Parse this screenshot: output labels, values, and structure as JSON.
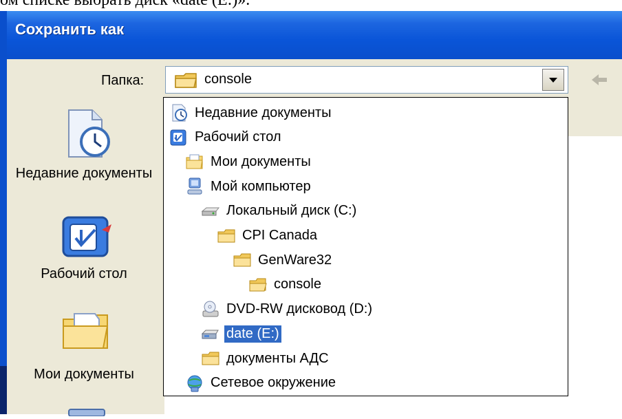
{
  "caption": "ом списке выбрать диск «date (E:)».",
  "window": {
    "title": "Сохранить как"
  },
  "folder_bar": {
    "label": "Папка:",
    "current_value": "console"
  },
  "places_bar": {
    "items": [
      {
        "label": "Недавние документы",
        "icon": "recent-documents-icon"
      },
      {
        "label": "Рабочий стол",
        "icon": "desktop-icon"
      },
      {
        "label": "Мои документы",
        "icon": "my-documents-icon"
      }
    ]
  },
  "dropdown": {
    "items": [
      {
        "label": "Недавние документы",
        "icon": "recent-documents-icon",
        "indent": 0,
        "selected": false
      },
      {
        "label": "Рабочий стол",
        "icon": "desktop-icon",
        "indent": 0,
        "selected": false
      },
      {
        "label": "Мои документы",
        "icon": "my-documents-icon",
        "indent": 1,
        "selected": false
      },
      {
        "label": "Мой компьютер",
        "icon": "my-computer-icon",
        "indent": 1,
        "selected": false
      },
      {
        "label": "Локальный диск (C:)",
        "icon": "hard-drive-icon",
        "indent": 2,
        "selected": false
      },
      {
        "label": "CPI Canada",
        "icon": "folder-icon",
        "indent": 3,
        "selected": false
      },
      {
        "label": "GenWare32",
        "icon": "folder-icon",
        "indent": 4,
        "selected": false
      },
      {
        "label": "console",
        "icon": "open-folder-icon",
        "indent": 5,
        "selected": false
      },
      {
        "label": "DVD-RW дисковод (D:)",
        "icon": "dvd-drive-icon",
        "indent": 2,
        "selected": false
      },
      {
        "label": "date (E:)",
        "icon": "drive-icon",
        "indent": 2,
        "selected": true
      },
      {
        "label": "документы АДС",
        "icon": "folder-icon",
        "indent": 2,
        "selected": false
      },
      {
        "label": "Сетевое окружение",
        "icon": "network-icon",
        "indent": 1,
        "selected": false
      }
    ]
  },
  "colors": {
    "title_bar": "#0a55d8",
    "dialog_face": "#ece9d8",
    "selection": "#316ac5"
  }
}
